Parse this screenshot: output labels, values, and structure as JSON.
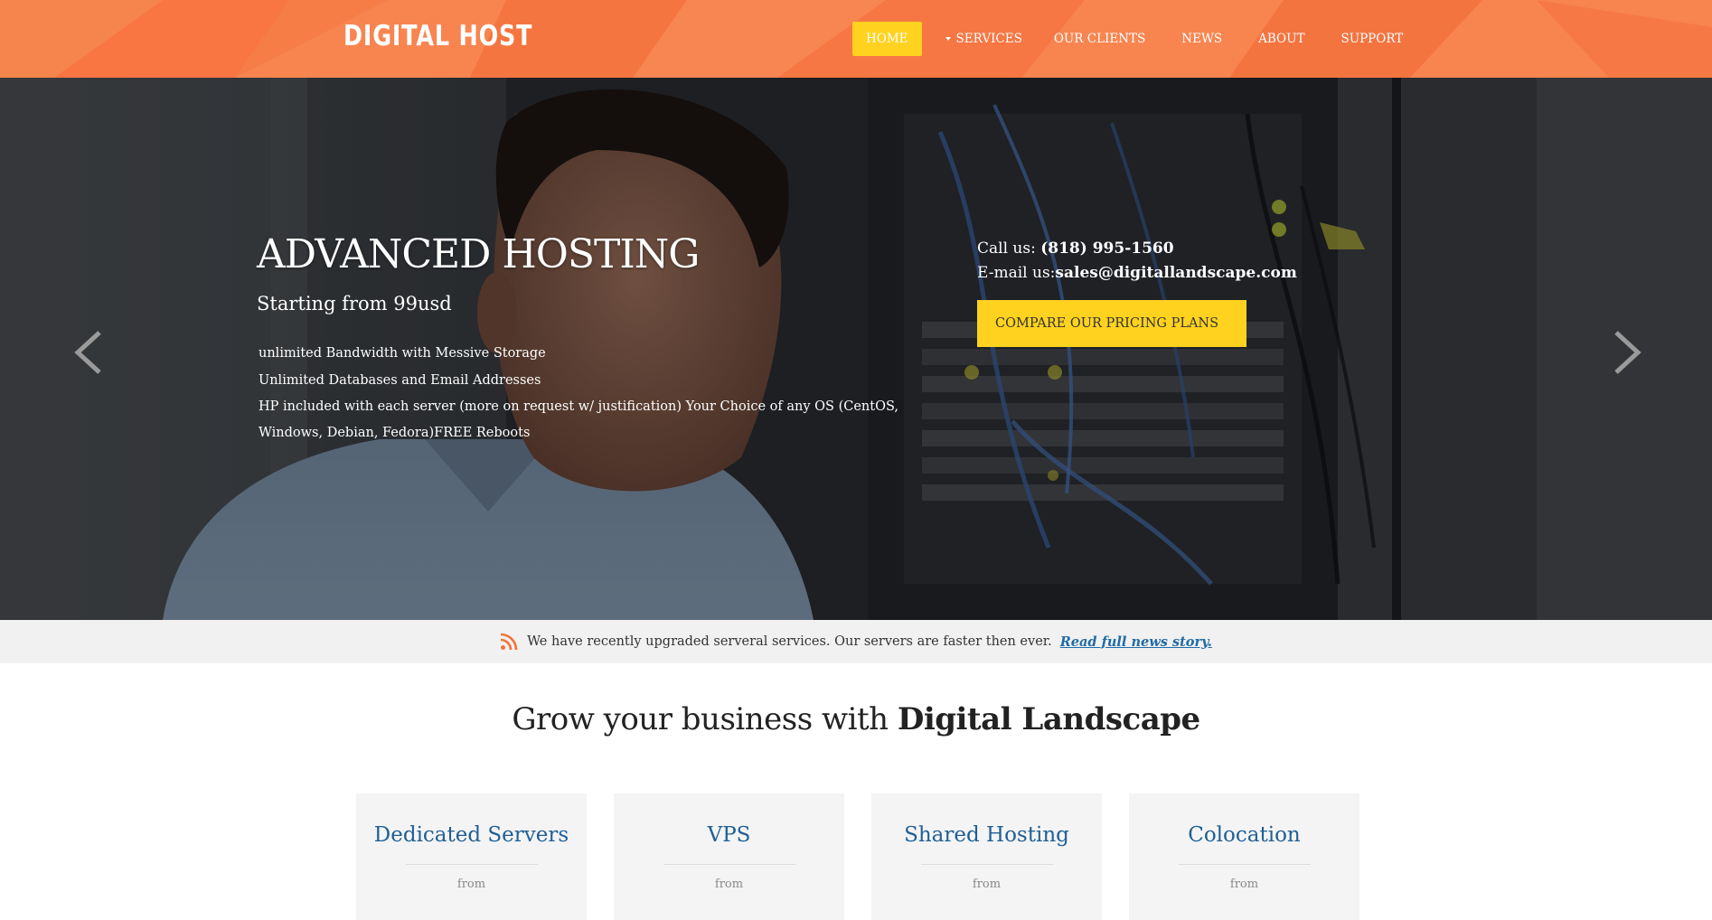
{
  "header": {
    "logo": "DIGITAL HOST",
    "nav": [
      {
        "label": "HOME",
        "active": true
      },
      {
        "label": "SERVICES",
        "dropdown": true
      },
      {
        "label": "OUR CLIENTS"
      },
      {
        "label": "NEWS"
      },
      {
        "label": "ABOUT"
      },
      {
        "label": "SUPPORT"
      }
    ],
    "colors": {
      "background": "#f77d47",
      "active": "#ffd21f"
    }
  },
  "hero": {
    "title": "ADVANCED HOSTING",
    "subtitle": "Starting from 99usd",
    "features": [
      "unlimited Bandwidth with Messive Storage",
      "Unlimited Databases and Email Addresses",
      "HP included with each server (more on request w/ justification) Your Choice of any OS (CentOS, Windows, Debian, Fedora)FREE Reboots"
    ],
    "call_label": "Call us: ",
    "phone": "(818) 995-1560",
    "email_label": "E-mail us:",
    "email": "sales@digitallandscape.com",
    "cta": "COMPARE OUR PRICING PLANS",
    "icons": {
      "prev": "chevron-left-icon",
      "next": "chevron-right-icon"
    }
  },
  "news": {
    "icon": "rss-icon",
    "text": "We have recently upgraded serveral services. Our servers are faster then ever.",
    "link": "Read full news story."
  },
  "grow": {
    "title_plain": "Grow your business with ",
    "title_bold": "Digital Landscape"
  },
  "cards": [
    {
      "title": "Dedicated Servers",
      "from": "from"
    },
    {
      "title": "VPS",
      "from": "from"
    },
    {
      "title": "Shared Hosting",
      "from": "from"
    },
    {
      "title": "Colocation",
      "from": "from"
    }
  ]
}
